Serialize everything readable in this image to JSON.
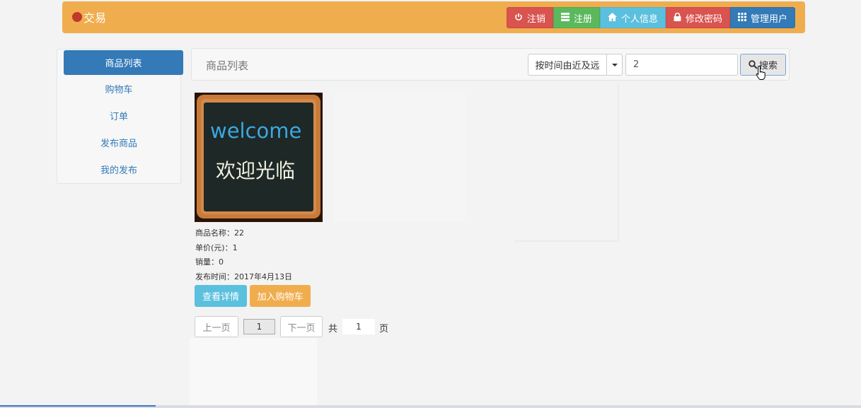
{
  "header": {
    "brand": "交易",
    "buttons": [
      {
        "label": "注销",
        "icon": "power-icon",
        "color": "#d9534f"
      },
      {
        "label": "注册",
        "icon": "list-icon",
        "color": "#5cb85c"
      },
      {
        "label": "个人信息",
        "icon": "home-icon",
        "color": "#5bc0de"
      },
      {
        "label": "修改密码",
        "icon": "lock-icon",
        "color": "#d9534f"
      },
      {
        "label": "管理用户",
        "icon": "grid-icon",
        "color": "#337ab7"
      }
    ]
  },
  "sidebar": {
    "items": [
      {
        "label": "商品列表",
        "active": true
      },
      {
        "label": "购物车"
      },
      {
        "label": "订单"
      },
      {
        "label": "发布商品"
      },
      {
        "label": "我的发布"
      }
    ]
  },
  "panel": {
    "title": "商品列表",
    "sort_label": "按时间由近及远",
    "search_value": "2",
    "search_label": "搜索"
  },
  "product": {
    "image": {
      "line1": "welcome",
      "line2": "欢迎光临"
    },
    "name_label": "商品名称：",
    "name": "22",
    "price_label": "单价(元)：",
    "price": "1",
    "sales_label": "销量：",
    "sales": "0",
    "date_label": "发布时间：",
    "date": "2017年4月13日",
    "detail_button": "查看详情",
    "cart_button": "加入购物车"
  },
  "pagination": {
    "prev": "上一页",
    "current": "1",
    "next": "下一页",
    "total_prefix": "共",
    "total": "1",
    "total_suffix": "页"
  },
  "colors": {
    "navbar": "#f0ad4e",
    "primary": "#337ab7",
    "danger": "#d9534f",
    "success": "#5cb85c",
    "info": "#5bc0de"
  }
}
